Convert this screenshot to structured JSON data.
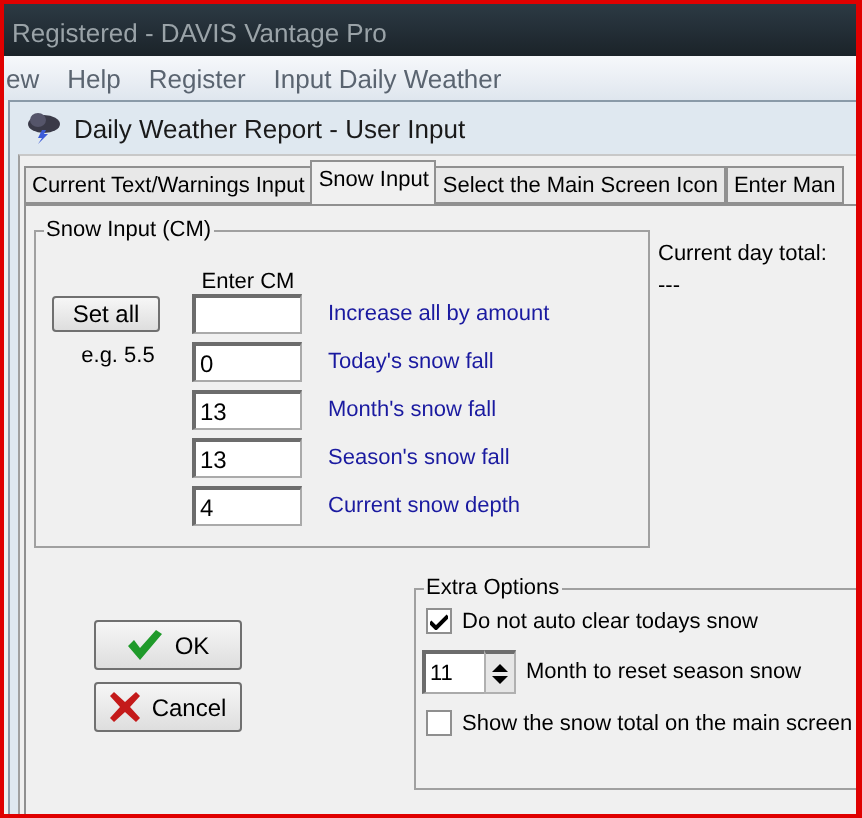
{
  "app_window": {
    "title": "Registered - DAVIS Vantage Pro"
  },
  "menu": [
    {
      "label": "ew"
    },
    {
      "label": "Help"
    },
    {
      "label": "Register"
    },
    {
      "label": "Input Daily Weather"
    }
  ],
  "dialog": {
    "title": "Daily Weather Report - User Input"
  },
  "tabs": [
    {
      "label": "Current Text/Warnings Input",
      "selected": false
    },
    {
      "label": "Snow Input",
      "selected": true
    },
    {
      "label": "Select the Main Screen Icon",
      "selected": false
    },
    {
      "label": "Enter Man",
      "selected": false
    }
  ],
  "snow_input": {
    "title": "Snow Input (CM)",
    "column_heading": "Enter CM",
    "set_all_button": "Set all",
    "example": "e.g. 5.5",
    "rows": [
      {
        "label": "Increase all by amount"
      },
      {
        "value": "0",
        "label": "Today's snow fall"
      },
      {
        "value": "13",
        "label": "Month's snow fall"
      },
      {
        "value": "13",
        "label": "Season's snow fall"
      },
      {
        "value": "4",
        "label": "Current snow depth"
      }
    ]
  },
  "current_day_total": {
    "label": "Current day total:",
    "value": "---"
  },
  "extra_options": {
    "title": "Extra Options",
    "items": [
      {
        "kind": "checkbox",
        "label": "Do not auto clear todays snow",
        "checked": true
      },
      {
        "kind": "spinner",
        "spinner_number": "11",
        "label": "Month to reset season snow"
      },
      {
        "kind": "checkbox",
        "label": "Show the snow total on the main screen",
        "checked": false
      }
    ]
  },
  "buttons": [
    {
      "kind": "ok",
      "label": "OK"
    },
    {
      "kind": "cancel",
      "label": "Cancel"
    }
  ]
}
